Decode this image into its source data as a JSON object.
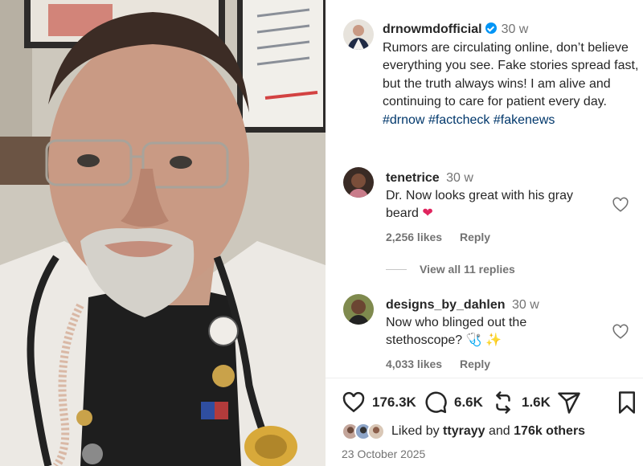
{
  "post": {
    "username": "drnowmdofficial",
    "time": "30 w",
    "caption": "Rumors are circulating online, don’t believe everything you see. Fake stories spread fast, but the truth always wins! I am alive and continuing to care for patient every day.",
    "hashtags": [
      "#drnow",
      "#factcheck",
      "#fakenews"
    ]
  },
  "comments": [
    {
      "username": "tenetrice",
      "time": "30 w",
      "text": "Dr. Now looks great with his gray beard",
      "emoji": "❤",
      "likes": "2,256 likes",
      "reply": "Reply"
    },
    {
      "username": "designs_by_dahlen",
      "time": "30 w",
      "text": "Now who blinged out the stethoscope?",
      "emoji": "🩺 ✨",
      "likes": "4,033 likes",
      "reply": "Reply"
    }
  ],
  "view_replies": "View all 11 replies",
  "actions": {
    "likes": "176.3K",
    "comments": "6.6K",
    "reposts": "1.6K",
    "icons": [
      "heart-icon",
      "comment-icon",
      "repost-icon",
      "share-icon",
      "bookmark-icon"
    ]
  },
  "liked_by": {
    "prefix": "Liked by",
    "user": "ttyrayy",
    "joiner": "and",
    "others": "176k others"
  },
  "date": "23 October 2025",
  "colors": {
    "hashtag": "#00376b",
    "verified": "#0095f6",
    "emoji_heart": "#e0245e"
  }
}
